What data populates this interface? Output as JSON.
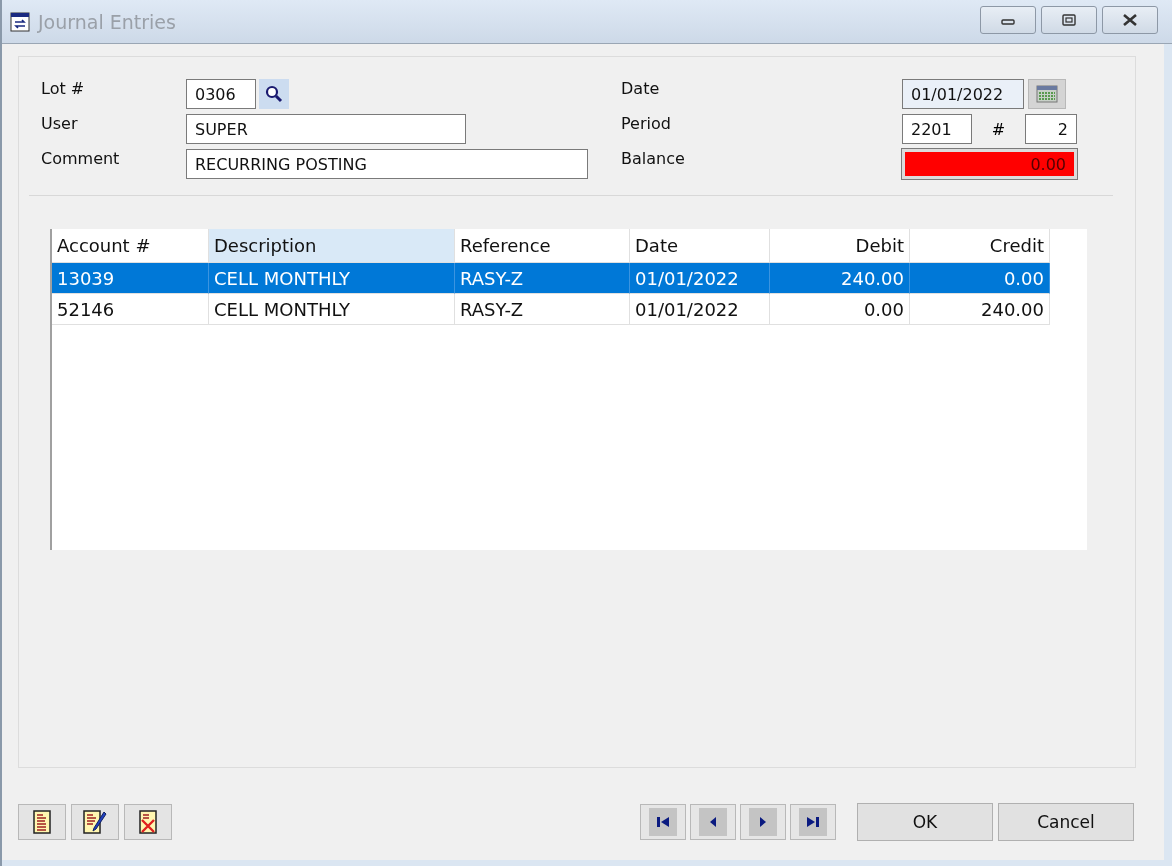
{
  "window": {
    "title": "Journal Entries"
  },
  "form": {
    "lot_label": "Lot #",
    "lot": "0306",
    "user_label": "User",
    "user": "SUPER",
    "comment_label": "Comment",
    "comment": "RECURRING POSTING",
    "date_label": "Date",
    "date": "01/01/2022",
    "period_label": "Period",
    "period": "2201",
    "number_label": "#",
    "number": "2",
    "balance_label": "Balance",
    "balance": "0.00",
    "balance_alert": true
  },
  "table": {
    "columns": [
      {
        "label": "Account #",
        "selected": false
      },
      {
        "label": "Description",
        "selected": true
      },
      {
        "label": "Reference",
        "selected": false
      },
      {
        "label": "Date",
        "selected": false
      },
      {
        "label": "Debit",
        "selected": false
      },
      {
        "label": "Credit",
        "selected": false
      }
    ],
    "rows": [
      {
        "cells": [
          "13039",
          "CELL MONTHLY",
          "RASY-Z",
          "01/01/2022",
          "240.00",
          "0.00"
        ],
        "selected": true
      },
      {
        "cells": [
          "52146",
          "CELL MONTHLY",
          "RASY-Z",
          "01/01/2022",
          "0.00",
          "240.00"
        ],
        "selected": false
      }
    ]
  },
  "buttons": {
    "ok": "OK",
    "cancel": "Cancel"
  }
}
